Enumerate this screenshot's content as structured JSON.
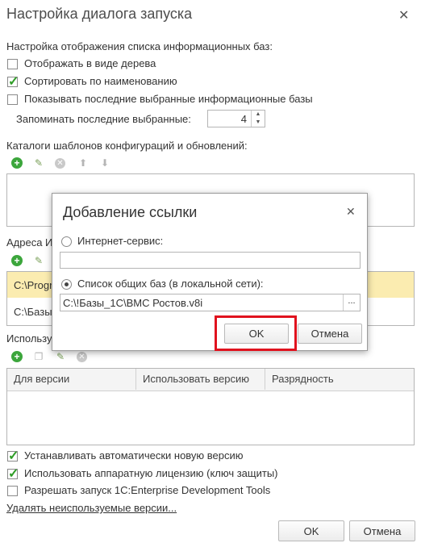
{
  "window": {
    "title": "Настройка диалога запуска",
    "close_icon": "close-icon"
  },
  "display": {
    "section_label": "Настройка отображения списка информационных баз:",
    "tree_label": "Отображать в виде дерева",
    "tree_checked": false,
    "sort_label": "Сортировать по наименованию",
    "sort_checked": true,
    "recent_label": "Показывать последние выбранные информационные базы",
    "recent_checked": false,
    "remember_label": "Запоминать последние выбранные:",
    "remember_value": "4"
  },
  "templates": {
    "section_label": "Каталоги шаблонов конфигураций и обновлений:",
    "toolbar_icons": [
      "add-icon",
      "edit-icon",
      "delete-icon",
      "move-up-icon",
      "move-down-icon"
    ]
  },
  "addresses": {
    "section_label_partial": "Адреса И",
    "rows": [
      "C:\\Progr",
      "C:\\Базы"
    ]
  },
  "versions": {
    "section_label_partial": "Использу",
    "columns": [
      "Для версии",
      "Использовать версию",
      "Разрядность"
    ]
  },
  "options": {
    "auto_install_label": "Устанавливать автоматически новую версию",
    "auto_install_checked": true,
    "hw_license_label": "Использовать аппаратную лицензию (ключ защиты)",
    "hw_license_checked": true,
    "edt_label": "Разрешать запуск 1C:Enterprise Development Tools",
    "edt_checked": false,
    "delete_unused_link": "Удалять неиспользуемые версии..."
  },
  "footer": {
    "ok_label": "OK",
    "cancel_label": "Отмена"
  },
  "dialog": {
    "title": "Добавление ссылки",
    "internet_label": "Интернет-сервис:",
    "internet_value": "",
    "shared_label": "Список общих баз (в локальной сети):",
    "shared_value": "C:\\!Базы_1С\\ВМС Ростов.v8i",
    "browse_label": "...",
    "ok_label": "OK",
    "cancel_label": "Отмена",
    "highlight_color": "#e0121e"
  },
  "colors": {
    "selected_row": "#fbecb0",
    "green_check": "#2f9d27",
    "green_plus": "#3ca63c"
  }
}
